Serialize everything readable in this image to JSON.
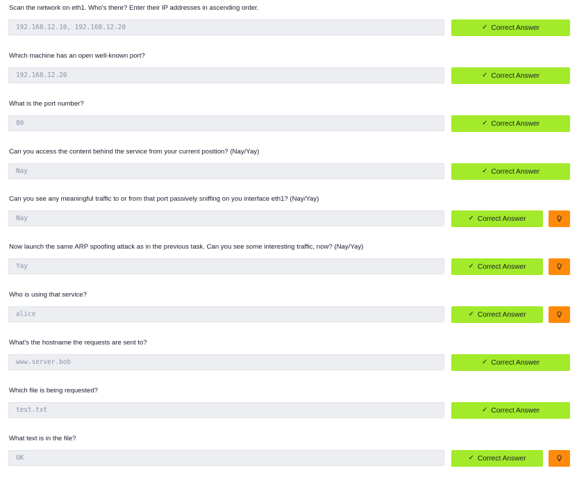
{
  "questions": [
    {
      "question": "Scan the network on eth1. Who's there? Enter their IP addresses in ascending order.",
      "answer": "192.168.12.10, 192.168.12.20",
      "button_label": "Correct Answer",
      "hint": false
    },
    {
      "question": "Which machine has an open well-known port?",
      "answer": "192.168.12.20",
      "button_label": "Correct Answer",
      "hint": false
    },
    {
      "question": "What is the port number?",
      "answer": "80",
      "button_label": "Correct Answer",
      "hint": false
    },
    {
      "question": "Can you access the content behind the service from your current position? (Nay/Yay)",
      "answer": "Nay",
      "button_label": "Correct Answer",
      "hint": false
    },
    {
      "question": "Can you see any meaningful traffic to or from that port passively sniffing on you interface eth1? (Nay/Yay)",
      "answer": "Nay",
      "button_label": "Correct Answer",
      "hint": true
    },
    {
      "question": "Now launch the same ARP spoofing attack as in the previous task. Can you see some interesting traffic, now? (Nay/Yay)",
      "answer": "Yay",
      "button_label": "Correct Answer",
      "hint": true
    },
    {
      "question": "Who is using that service?",
      "answer": "alice",
      "button_label": "Correct Answer",
      "hint": true
    },
    {
      "question": "What's the hostname the requests are sent to?",
      "answer": "www.server.bob",
      "button_label": "Correct Answer",
      "hint": false
    },
    {
      "question": "Which file is being requested?",
      "answer": "test.txt",
      "button_label": "Correct Answer",
      "hint": false
    },
    {
      "question": "What text is in the file?",
      "answer": "OK",
      "button_label": "Correct Answer",
      "hint": true
    }
  ],
  "icons": {
    "check": "check-icon",
    "hint": "lightbulb-icon"
  },
  "colors": {
    "correct_button": "#a3ea2a",
    "hint_button": "#ff8a0a",
    "answer_field": "#eceef2"
  }
}
